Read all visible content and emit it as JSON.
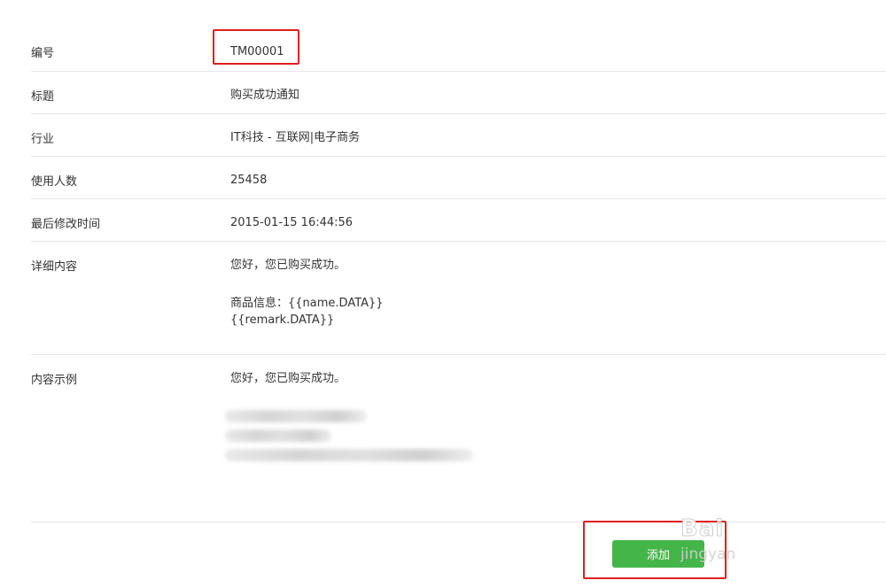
{
  "fields": {
    "id": {
      "label": "编号",
      "value": "TM00001"
    },
    "title": {
      "label": "标题",
      "value": "购买成功通知"
    },
    "industry": {
      "label": "行业",
      "value": "IT科技 - 互联网|电子商务"
    },
    "users": {
      "label": "使用人数",
      "value": "25458"
    },
    "modified": {
      "label": "最后修改时间",
      "value": "2015-01-15 16:44:56"
    },
    "detail": {
      "label": "详细内容",
      "line1": "您好，您已购买成功。",
      "line2": "商品信息：{{name.DATA}}",
      "line3": "{{remark.DATA}}"
    },
    "example": {
      "label": "内容示例",
      "line1": "您好，您已购买成功。"
    }
  },
  "actions": {
    "add_label": "添加"
  },
  "watermark": {
    "top": "Bai",
    "bottom": "jingyan"
  },
  "colors": {
    "accent": "#44b549",
    "highlight": "#e02020",
    "divider": "#e7e7eb"
  }
}
